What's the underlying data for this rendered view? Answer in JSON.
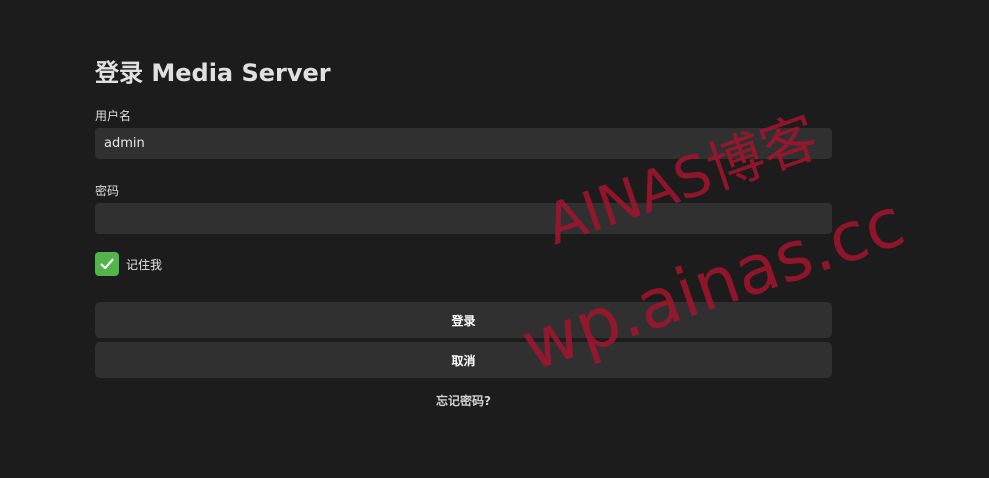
{
  "login": {
    "title": "登录 Media Server",
    "username_label": "用户名",
    "username_value": "admin",
    "password_label": "密码",
    "password_value": "",
    "remember_label": "记住我",
    "remember_checked": true,
    "login_button": "登录",
    "cancel_button": "取消",
    "forgot_link": "忘记密码?"
  },
  "watermark": {
    "line1": "AINAS博客",
    "line2": "wp.ainas.cc"
  },
  "colors": {
    "background": "#1c1c1c",
    "input_bg": "#303030",
    "checkbox_accent": "#52b54b",
    "watermark": "#aa142d"
  },
  "icons": {
    "checkbox": "check-icon"
  }
}
